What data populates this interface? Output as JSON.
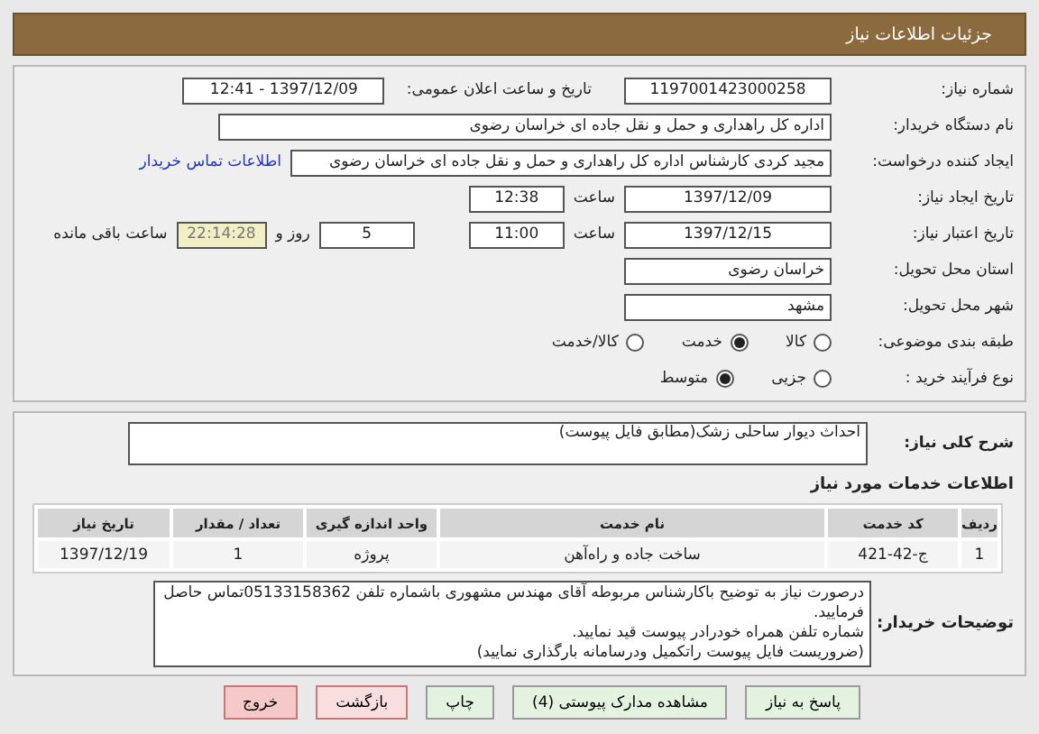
{
  "header": {
    "title": "جزئیات اطلاعات نیاز"
  },
  "need_number": {
    "label": "شماره نیاز:",
    "value": "1197001423000258"
  },
  "announce": {
    "label": "تاریخ و ساعت اعلان عمومی:",
    "value": "1397/12/09 - 12:41"
  },
  "buyer_org": {
    "label": "نام دستگاه خریدار:",
    "value": "اداره کل راهداری و حمل و نقل جاده ای خراسان رضوی"
  },
  "requester": {
    "label": "ایجاد کننده درخواست:",
    "value": "مجید کردی کارشناس اداره کل راهداری و حمل و نقل جاده ای خراسان رضوی",
    "link": "اطلاعات تماس خریدار"
  },
  "created": {
    "label": "تاریخ ایجاد نیاز:",
    "date": "1397/12/09",
    "time_label": "ساعت",
    "time": "12:38"
  },
  "validity": {
    "label": "تاریخ اعتبار نیاز:",
    "date": "1397/12/15",
    "time_label": "ساعت",
    "time": "11:00",
    "days": "5",
    "days_label": "روز و",
    "remaining": "22:14:28",
    "remaining_label": "ساعت باقی مانده"
  },
  "province": {
    "label": "استان محل تحویل:",
    "value": "خراسان رضوی"
  },
  "city": {
    "label": "شهر محل تحویل:",
    "value": "مشهد"
  },
  "category": {
    "label": "طبقه بندی موضوعی:",
    "options": [
      {
        "label": "کالا",
        "selected": false
      },
      {
        "label": "خدمت",
        "selected": true
      },
      {
        "label": "کالا/خدمت",
        "selected": false
      }
    ]
  },
  "purchase_type": {
    "label": "نوع فرآیند خرید :",
    "options": [
      {
        "label": "جزیی",
        "selected": false
      },
      {
        "label": "متوسط",
        "selected": true
      }
    ]
  },
  "description": {
    "label": "شرح کلی نیاز:",
    "value": "احداث دیوار ساحلی زشک(مطابق فایل پیوست)"
  },
  "services": {
    "title": "اطلاعات خدمات مورد نیاز",
    "columns": [
      "ردیف",
      "کد خدمت",
      "نام خدمت",
      "واحد اندازه گیری",
      "تعداد / مقدار",
      "تاریخ نیاز"
    ],
    "rows": [
      [
        "1",
        "ج-42-421",
        "ساخت جاده و راه‌آهن",
        "پروژه",
        "1",
        "1397/12/19"
      ]
    ]
  },
  "buyer_notes": {
    "label": "توضیحات خریدار:",
    "lines": [
      "درصورت نیاز به توضیح باکارشناس مربوطه آقای مهندس مشهوری باشماره تلفن 05133158362تماس حاصل فرمایید.",
      "شماره تلفن همراه خودرادر پیوست قید نمایید.",
      "(ضروریست فایل پیوست راتکمیل ودرسامانه بارگذاری نمایید)"
    ]
  },
  "buttons": [
    {
      "label": "پاسخ به نیاز",
      "kind": "normal"
    },
    {
      "label": "مشاهده مدارک پیوستی (4)",
      "kind": "normal"
    },
    {
      "label": "چاپ",
      "kind": "normal"
    },
    {
      "label": "بازگشت",
      "kind": "back"
    },
    {
      "label": "خروج",
      "kind": "exit"
    }
  ]
}
